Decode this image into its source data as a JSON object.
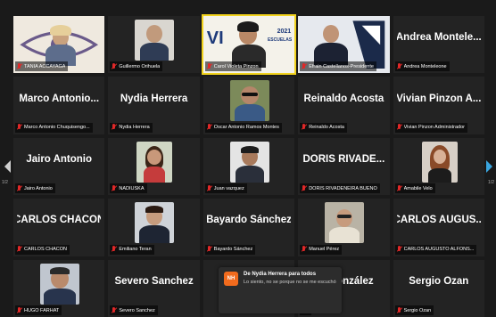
{
  "grid": {
    "tiles": [
      {
        "label": "TANIA ACCAYAGA",
        "big": ""
      },
      {
        "label": "Guillermo Orihuela",
        "big": ""
      },
      {
        "label": "Carol Violeta Pinzon",
        "big": ""
      },
      {
        "label": "Efrain Castellanos-Presidente",
        "big": ""
      },
      {
        "label": "Andrea Monteleone",
        "big": "Andrea Montele..."
      },
      {
        "label": "Marco Antonio Chuquisengo...",
        "big": "Marco Antonio..."
      },
      {
        "label": "Nydia Herrera",
        "big": "Nydia Herrera"
      },
      {
        "label": "Oscar Antonio Ramos Montes",
        "big": ""
      },
      {
        "label": "Reinaldo Acosta",
        "big": "Reinaldo Acosta"
      },
      {
        "label": "Vivian Pinzon Administrador",
        "big": "Vivian Pinzon A..."
      },
      {
        "label": "Jairo Antonio",
        "big": "Jairo Antonio"
      },
      {
        "label": "NADIUSKA",
        "big": ""
      },
      {
        "label": "Juan vazquez",
        "big": ""
      },
      {
        "label": "DORIS RIVADENEIRA BUENO",
        "big": "DORIS RIVADE..."
      },
      {
        "label": "Amabile Velo",
        "big": ""
      },
      {
        "label": "CARLOS CHACON",
        "big": "CARLOS CHACON"
      },
      {
        "label": "Emiliano Teran",
        "big": ""
      },
      {
        "label": "Bayardo Sánchez",
        "big": "Bayardo Sánchez"
      },
      {
        "label": "Manuel Pérez",
        "big": ""
      },
      {
        "label": "CARLOS AUGUSTO ALFONS...",
        "big": "CARLOS AUGUS..."
      },
      {
        "label": "HUGO FARHAT",
        "big": ""
      },
      {
        "label": "Severo Sanchez",
        "big": "Severo Sanchez"
      },
      {
        "label": "",
        "big": ""
      },
      {
        "label": "",
        "big": "González"
      },
      {
        "label": "Sergio Ozan",
        "big": "Sergio Ozan"
      }
    ]
  },
  "pager": {
    "left_num": "1/2",
    "right_num": "1/2"
  },
  "chat": {
    "avatar_initials": "NH",
    "from": "De Nydia Herrera para todos",
    "message": "Lo siento, no se porque no se me escuchó"
  },
  "banner_text": {
    "year": "2021",
    "word": "ESCUELAS",
    "letters": "VI"
  }
}
